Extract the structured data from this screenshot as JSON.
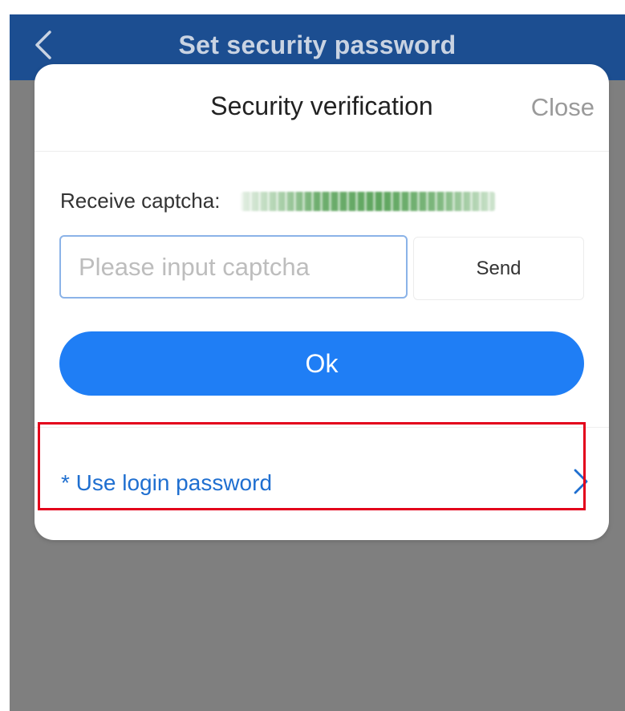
{
  "nav": {
    "title": "Set security password",
    "back_icon": "chevron-left-icon"
  },
  "dialog": {
    "title": "Security verification",
    "close_label": "Close",
    "receive_label": "Receive captcha:",
    "captcha_placeholder": "Please input captcha",
    "send_label": "Send",
    "ok_label": "Ok",
    "login_password_label": "* Use login password",
    "login_arrow_icon": "chevron-right-icon"
  },
  "colors": {
    "nav_bar": "#1c4e91",
    "overlay": "#7f7f7f",
    "primary_button": "#1f7ef5",
    "link_text": "#1f6fd0",
    "highlight": "#e3001b"
  }
}
